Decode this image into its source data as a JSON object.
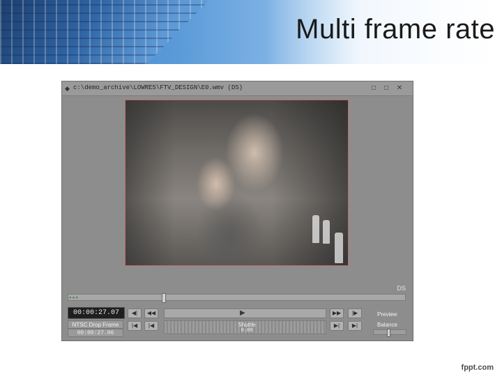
{
  "slide": {
    "title": "Multi frame rate",
    "watermark": "fppt.com"
  },
  "player": {
    "window_title": "c:\\demo_archive\\LOWRES\\FTV_DESIGN\\E0.wmv   (DS)",
    "window_icon": "app-icon",
    "minimize_glyph": "□",
    "restore_glyph": "□",
    "close_glyph": "✕",
    "channel_label": "DS",
    "timecode_main": "00:00:27.07",
    "timecode_label": "NTSC Drop Frame",
    "timecode_sub": "00:00:27.06",
    "shuttle_label": "Shuttle",
    "shuttle_value": "0.00",
    "preview_label": "Preview",
    "balance_label": "Balance",
    "scrub_position_fraction": 0.28,
    "balance_position_fraction": 0.45,
    "buttons": {
      "prev_mark": "◀|",
      "rewind": "◀◀",
      "play": "▶",
      "fast_forward": "▶▶",
      "next_mark": "|▶",
      "go_start": "|◀",
      "step_back": "|◀",
      "step_forward": "▶|",
      "go_end": "▶|"
    }
  },
  "colors": {
    "banner_blue": "#3e7fc6",
    "player_gray": "#8d8d8d",
    "video_border": "#c46a6a",
    "timecode_bg": "#1f1f1f"
  }
}
